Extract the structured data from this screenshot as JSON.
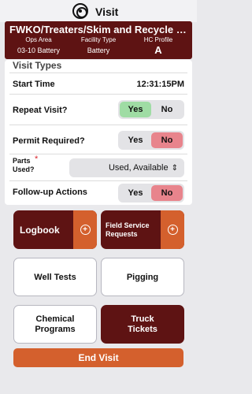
{
  "header": {
    "title": "Visit"
  },
  "banner": {
    "facility_name": "FWKO/Treaters/Skim and Recycle Pu...",
    "ops_area_label": "Ops Area",
    "ops_area_value": "03-10 Battery",
    "facility_type_label": "Facility Type",
    "facility_type_value": "Battery",
    "hc_profile_label": "HC Profile",
    "hc_profile_value": "A"
  },
  "visit_types": {
    "section_title": "Visit Types",
    "start_time_label": "Start Time",
    "start_time_value": "12:31:15PM",
    "repeat_visit": {
      "label": "Repeat Visit?",
      "yes": "Yes",
      "no": "No",
      "selected": "Yes"
    },
    "permit_required": {
      "label": "Permit Required?",
      "yes": "Yes",
      "no": "No",
      "selected": "No"
    },
    "parts_used": {
      "label": "Parts Used?",
      "required_mark": "*",
      "value": "Used, Available"
    },
    "follow_up": {
      "label": "Follow-up Actions",
      "yes": "Yes",
      "no": "No",
      "selected": "No"
    }
  },
  "actions": {
    "logbook": "Logbook",
    "field_service": "Field Service Requests",
    "well_tests": "Well Tests",
    "pigging": "Pigging",
    "chemical_programs": "Chemical Programs",
    "truck_tickets": "Truck Tickets",
    "end_visit": "End Visit"
  },
  "colors": {
    "maroon": "#5e1313",
    "orange": "#d4602d",
    "yes_green": "#9fdca4",
    "no_red": "#e8848c"
  },
  "icons": {
    "logo": "target-logo-icon",
    "add": "plus-circle-icon",
    "dropdown": "chevron-updown-icon"
  }
}
